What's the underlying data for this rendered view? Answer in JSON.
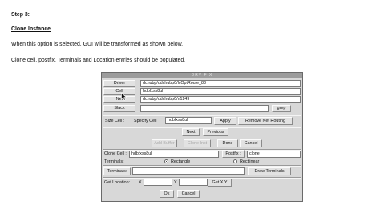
{
  "doc": {
    "step": "Step 3:",
    "section_title": "Clone Instance",
    "para1": "When this option is selected, GUI will be transformed as shown below.",
    "para2": "Clone cell, postfix, Terminals and Location entries should be populated."
  },
  "window": {
    "title": "DRV FIX"
  },
  "rows": {
    "driver": {
      "label": "Driver",
      "value": "dchubp/udchubp0/lcOptRoute_83"
    },
    "cell": {
      "label": "Cell",
      "value": "hdbfxss8ul"
    },
    "net": {
      "label": "Net",
      "value": "dchubp/udchubp0/n1249"
    },
    "slack": {
      "label": "Slack",
      "value": "",
      "grep": "grep"
    }
  },
  "size_cell": {
    "group_label": "Size Cell :",
    "specify_label": "Specify Cell",
    "value": "hdbfxss8ul",
    "apply": "Apply",
    "remove_routing": "Remove Net Routing"
  },
  "nav": {
    "next": "Next",
    "previous": "Previous"
  },
  "actions": {
    "add_buffer": "Add Buffer",
    "clone_inst": "Clone Inst",
    "done": "Done",
    "cancel": "Cancel"
  },
  "clone": {
    "clone_cell_label": "Clone Cell :",
    "clone_cell_value": "hdbfxss8ul",
    "postfix_label": "Postfix :",
    "postfix_value": "clone"
  },
  "terminals": {
    "group_label": "Terminals:",
    "rectangle": "Rectangle",
    "rectilinear": "Rectlinear",
    "selected": "rectangle",
    "field_label": "Terminals:",
    "value": "",
    "draw_button": "Draw Terminals"
  },
  "location": {
    "label": "Get Location:",
    "x_label": "X",
    "x_value": "",
    "y_label": "Y",
    "y_value": "",
    "get_button": "Get X,Y"
  },
  "footer": {
    "ok": "Ok",
    "cancel": "Cancel"
  }
}
